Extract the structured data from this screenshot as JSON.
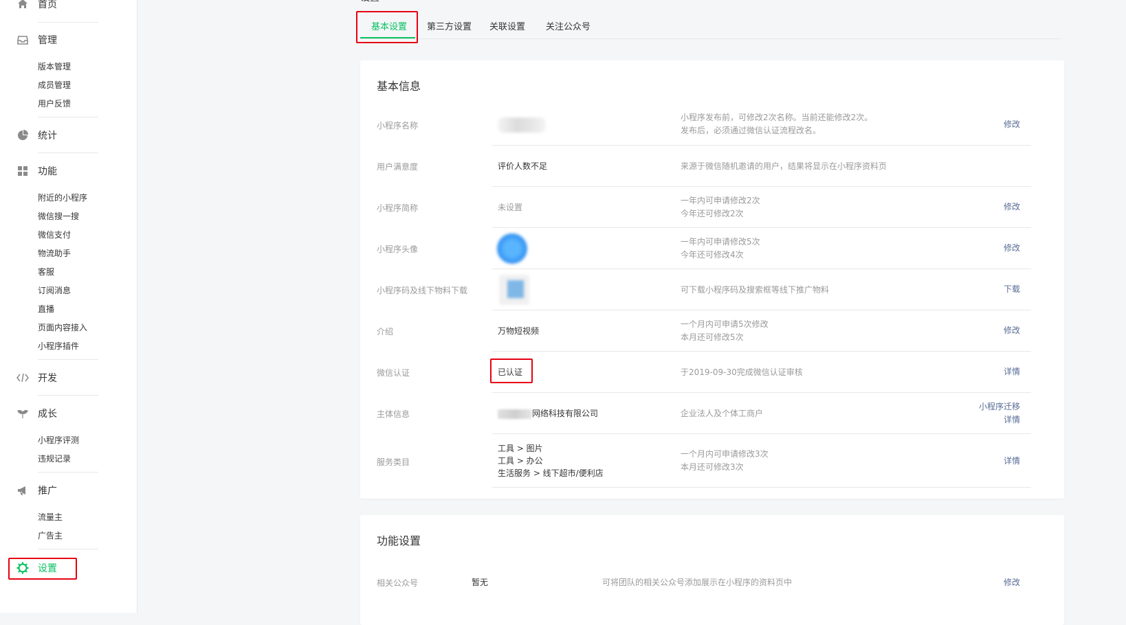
{
  "colors": {
    "accent": "#07c160",
    "link": "#576b95",
    "highlight_box": "#e60012"
  },
  "sidebar": {
    "home": {
      "label": "首页",
      "icon": "home-icon"
    },
    "manage": {
      "label": "管理",
      "icon": "inbox-icon",
      "items": [
        "版本管理",
        "成员管理",
        "用户反馈"
      ]
    },
    "stats": {
      "label": "统计",
      "icon": "pie-chart-icon"
    },
    "features": {
      "label": "功能",
      "icon": "grid-icon",
      "items": [
        "附近的小程序",
        "微信搜一搜",
        "微信支付",
        "物流助手",
        "客服",
        "订阅消息",
        "直播",
        "页面内容接入",
        "小程序插件"
      ]
    },
    "dev": {
      "label": "开发",
      "icon": "code-icon"
    },
    "growth": {
      "label": "成长",
      "icon": "sprout-icon",
      "items": [
        "小程序评测",
        "违规记录"
      ]
    },
    "promo": {
      "label": "推广",
      "icon": "megaphone-icon",
      "items": [
        "流量主",
        "广告主"
      ]
    },
    "settings": {
      "label": "设置",
      "icon": "gear-icon",
      "active": true
    }
  },
  "page": {
    "title": "设置",
    "tabs": [
      "基本设置",
      "第三方设置",
      "关联设置",
      "关注公众号"
    ],
    "active_tab": "基本设置"
  },
  "basic_info": {
    "title": "基本信息",
    "rows": [
      {
        "label": "小程序名称",
        "value": "",
        "desc": [
          "小程序发布前，可修改2次名称。当前还能修改2次。",
          "发布后，必须通过微信认证流程改名。"
        ],
        "action": [
          "修改"
        ]
      },
      {
        "label": "用户满意度",
        "value": "评价人数不足",
        "desc": [
          "来源于微信随机邀请的用户，结果将显示在小程序资料页"
        ],
        "action": []
      },
      {
        "label": "小程序简称",
        "value": "未设置",
        "desc": [
          "一年内可申请修改2次",
          "今年还可修改2次"
        ],
        "action": [
          "修改"
        ]
      },
      {
        "label": "小程序头像",
        "value": "",
        "desc": [
          "一年内可申请修改5次",
          "今年还可修改4次"
        ],
        "action": [
          "修改"
        ]
      },
      {
        "label": "小程序码及线下物料下载",
        "value": "",
        "desc": [
          "可下载小程序码及搜索框等线下推广物料"
        ],
        "action": [
          "下载"
        ]
      },
      {
        "label": "介绍",
        "value": "万物短视频",
        "desc": [
          "一个月内可申请5次修改",
          "本月还可修改5次"
        ],
        "action": [
          "修改"
        ]
      },
      {
        "label": "微信认证",
        "value": "已认证",
        "desc": [
          "于2019-09-30完成微信认证审核"
        ],
        "action": [
          "详情"
        ]
      },
      {
        "label": "主体信息",
        "value": "网络科技有限公司",
        "desc": [
          "企业法人及个体工商户"
        ],
        "action": [
          "小程序迁移",
          "详情"
        ]
      },
      {
        "label": "服务类目",
        "value_lines": [
          "工具 > 图片",
          "工具 > 办公",
          "生活服务 > 线下超市/便利店"
        ],
        "desc": [
          "一个月内可申请修改3次",
          "本月还可修改3次"
        ],
        "action": [
          "详情"
        ]
      }
    ]
  },
  "feature_settings": {
    "title": "功能设置",
    "rows": [
      {
        "label": "相关公众号",
        "value": "暂无",
        "desc": "可将团队的相关公众号添加展示在小程序的资料页中",
        "action": "修改"
      }
    ]
  }
}
